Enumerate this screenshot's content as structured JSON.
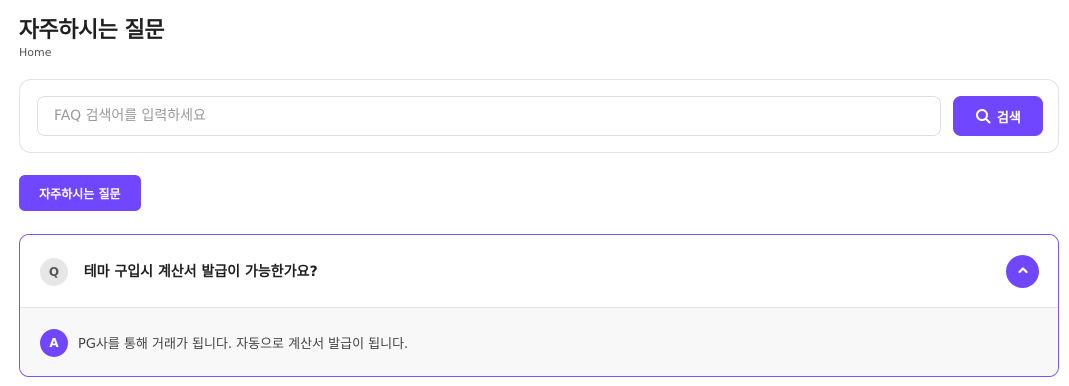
{
  "page": {
    "title": "자주하시는 질문",
    "breadcrumb": "Home"
  },
  "search": {
    "placeholder": "FAQ 검색어를 입력하세요",
    "value": "",
    "button_label": "검색",
    "button_icon": "search-icon"
  },
  "category": {
    "active_label": "자주하시는 질문"
  },
  "faq": {
    "items": [
      {
        "q_badge": "Q",
        "question": "테마 구입시 계산서 발급이 가능한가요?",
        "a_badge": "A",
        "answer": "PG사를 통해 거래가 됩니다. 자동으로 계산서 발급이 됩니다.",
        "expanded": true,
        "toggle_icon": "chevron-up-icon"
      }
    ]
  },
  "colors": {
    "accent": "#7047ff",
    "border": "#e2e2e2",
    "answer_bg": "#f8f8f8"
  }
}
